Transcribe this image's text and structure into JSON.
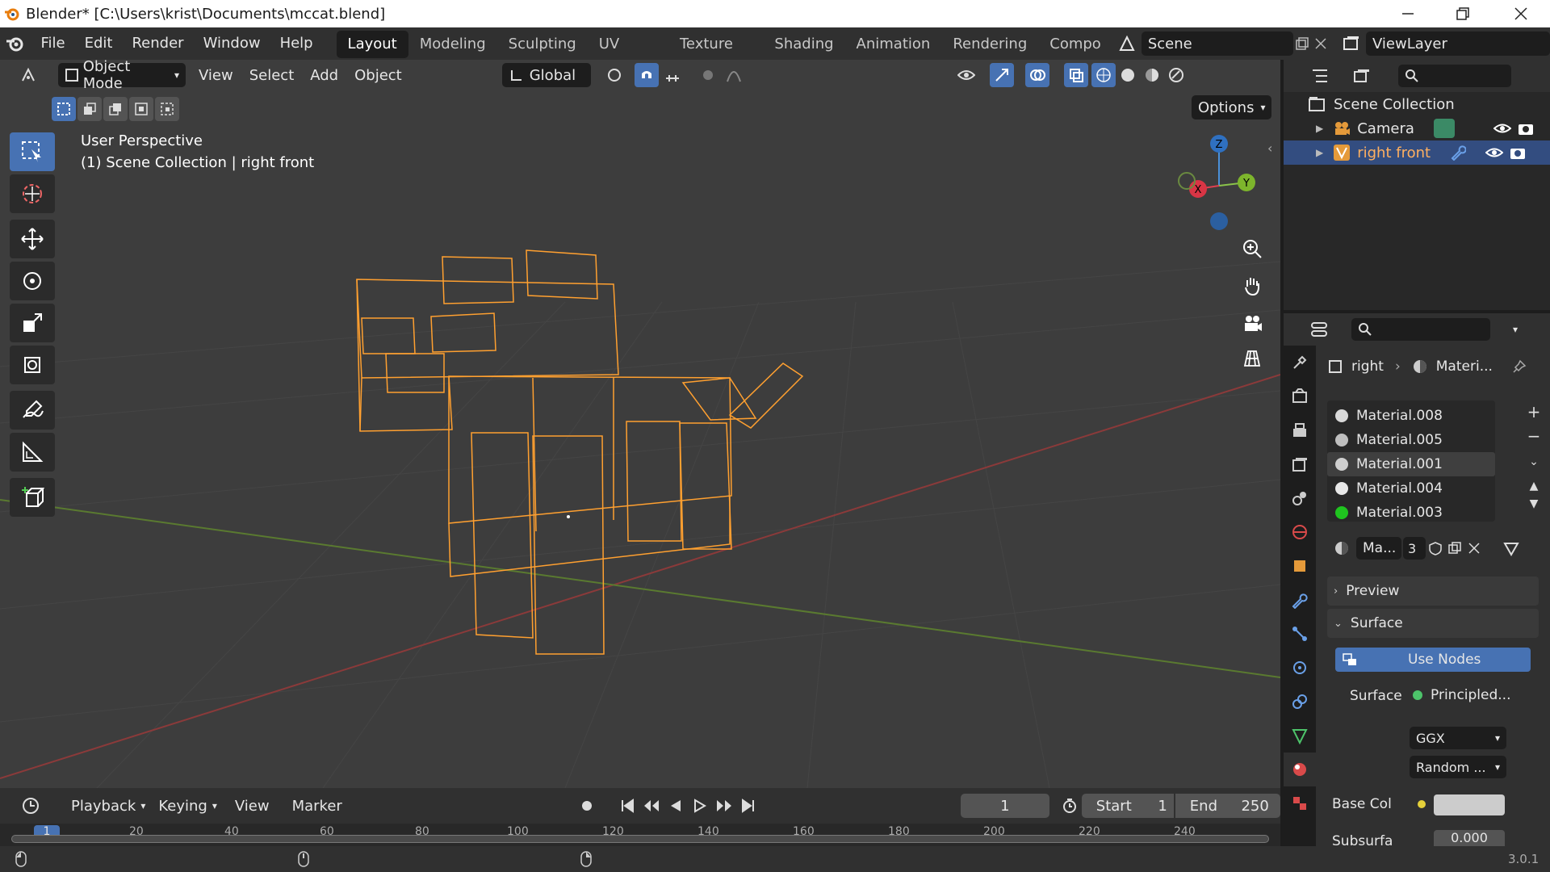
{
  "window": {
    "title": "Blender* [C:\\Users\\krist\\Documents\\mccat.blend]"
  },
  "menu": [
    "File",
    "Edit",
    "Render",
    "Window",
    "Help"
  ],
  "workspaces": [
    "Layout",
    "Modeling",
    "Sculpting",
    "UV Editing",
    "Texture Paint",
    "Shading",
    "Animation",
    "Rendering",
    "Compo"
  ],
  "scene": {
    "name": "Scene",
    "view_layer": "ViewLayer"
  },
  "viewport_header": {
    "mode": "Object Mode",
    "menus": [
      "View",
      "Select",
      "Add",
      "Object"
    ],
    "transform": "Global",
    "options": "Options"
  },
  "viewport_overlay": {
    "line1": "User Perspective",
    "line2": "(1) Scene Collection | right front"
  },
  "gizmo": {
    "x": "X",
    "y": "Y",
    "z": "Z"
  },
  "outliner": {
    "collection": "Scene Collection",
    "items": [
      {
        "name": "Camera",
        "selected": false
      },
      {
        "name": "right front",
        "selected": true
      }
    ]
  },
  "properties": {
    "breadcrumb_obj": "right",
    "breadcrumb_mat": "Materi...",
    "materials": [
      {
        "name": "Material.008",
        "color": "#d9d9d9",
        "selected": false
      },
      {
        "name": "Material.005",
        "color": "#bfbfbf",
        "selected": false
      },
      {
        "name": "Material.001",
        "color": "#cfcfcf",
        "selected": true
      },
      {
        "name": "Material.004",
        "color": "#e8e8e8",
        "selected": false
      },
      {
        "name": "Material.003",
        "color": "#1fc41f",
        "selected": false
      }
    ],
    "slot_name": "Ma...",
    "slot_users": "3",
    "preview_label": "Preview",
    "surface_label": "Surface",
    "use_nodes": "Use Nodes",
    "surface_field_label": "Surface",
    "surface_value": "Principled...",
    "distribution": "GGX",
    "subsurface_method": "Random ...",
    "base_color_label": "Base Col",
    "subsurface_label": "Subsurfa",
    "subsurface_value": "0.000"
  },
  "timeline": {
    "menus": [
      "Playback",
      "Keying",
      "View",
      "Marker"
    ],
    "current_frame": "1",
    "start_label": "Start",
    "start": "1",
    "end_label": "End",
    "end": "250",
    "ticks": [
      "1",
      "20",
      "40",
      "60",
      "80",
      "100",
      "120",
      "140",
      "160",
      "180",
      "200",
      "220",
      "240"
    ]
  },
  "status": {
    "version": "3.0.1"
  },
  "colors": {
    "accent": "#4772b3",
    "selection": "#ffa030",
    "bg": "#3d3d3d"
  }
}
